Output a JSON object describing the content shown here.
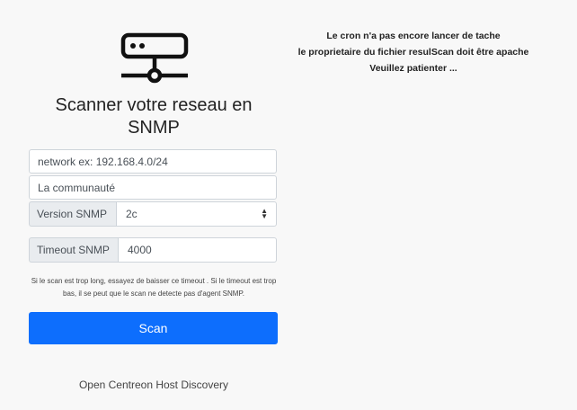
{
  "header": {
    "title": "Scanner votre reseau en SNMP",
    "logo_icon": "network-server-icon"
  },
  "form": {
    "network": {
      "placeholder": "network ex: 192.168.4.0/24",
      "value": ""
    },
    "community": {
      "placeholder": "La communauté",
      "value": ""
    },
    "version": {
      "label": "Version SNMP",
      "selected": "2c",
      "icon": "select-chevron-icon"
    },
    "timeout": {
      "label": "Timeout SNMP",
      "value": "4000"
    },
    "help_text": "Si le scan est trop long, essayez de baisser ce timeout . Si le timeout est trop bas, il se peut que le scan ne detecte pas d'agent SNMP.",
    "scan_label": "Scan"
  },
  "footer": {
    "discovery_link": "Open Centreon Host Discovery"
  },
  "notice": {
    "line1": "Le cron n'a pas encore lancer de tache",
    "line2": "le proprietaire du fichier resulScan doit être apache",
    "line3": "Veuillez patienter ..."
  },
  "colors": {
    "background": "#f8f8f8",
    "primary": "#0d6efd",
    "addon": "#e9ecef",
    "border": "#ced4da"
  }
}
